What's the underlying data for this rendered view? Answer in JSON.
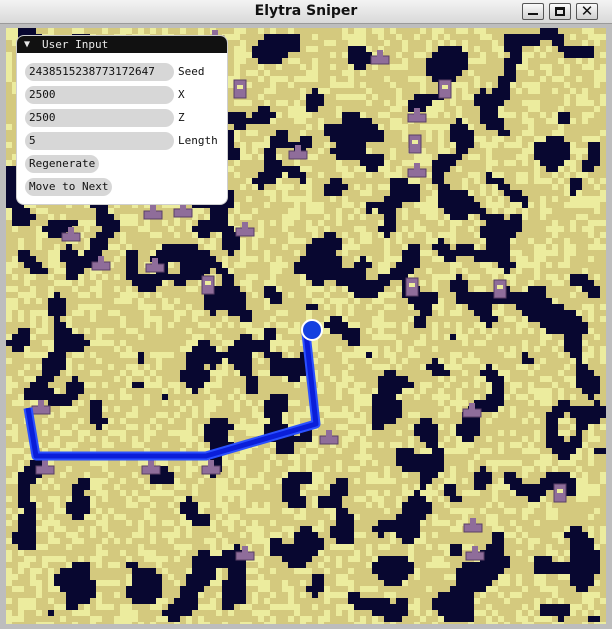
{
  "window": {
    "title": "Elytra Sniper",
    "minimize_icon": "minimize-icon",
    "maximize_icon": "maximize-icon",
    "close_icon": "close-icon",
    "close_glyph": "✕"
  },
  "panel": {
    "title": "User Input",
    "collapse_glyph": "▼",
    "fields": {
      "seed": {
        "value": "2438515238773172647",
        "label": "Seed"
      },
      "x": {
        "value": "2500",
        "label": "X"
      },
      "z": {
        "value": "2500",
        "label": "Z"
      },
      "length": {
        "value": "5",
        "label": "Length"
      }
    },
    "regenerate_label": "Regenerate",
    "move_next_label": "Move to Next"
  },
  "map": {
    "colors": {
      "ocean": "#080730",
      "land": "#d4c97e",
      "land_light": "#ecec9e",
      "route": "#0a1ed8",
      "route_edge": "#2a50ff",
      "marker": "#8f6d9a",
      "marker_dark": "#5a3f66",
      "player": "#1440e0"
    }
  }
}
